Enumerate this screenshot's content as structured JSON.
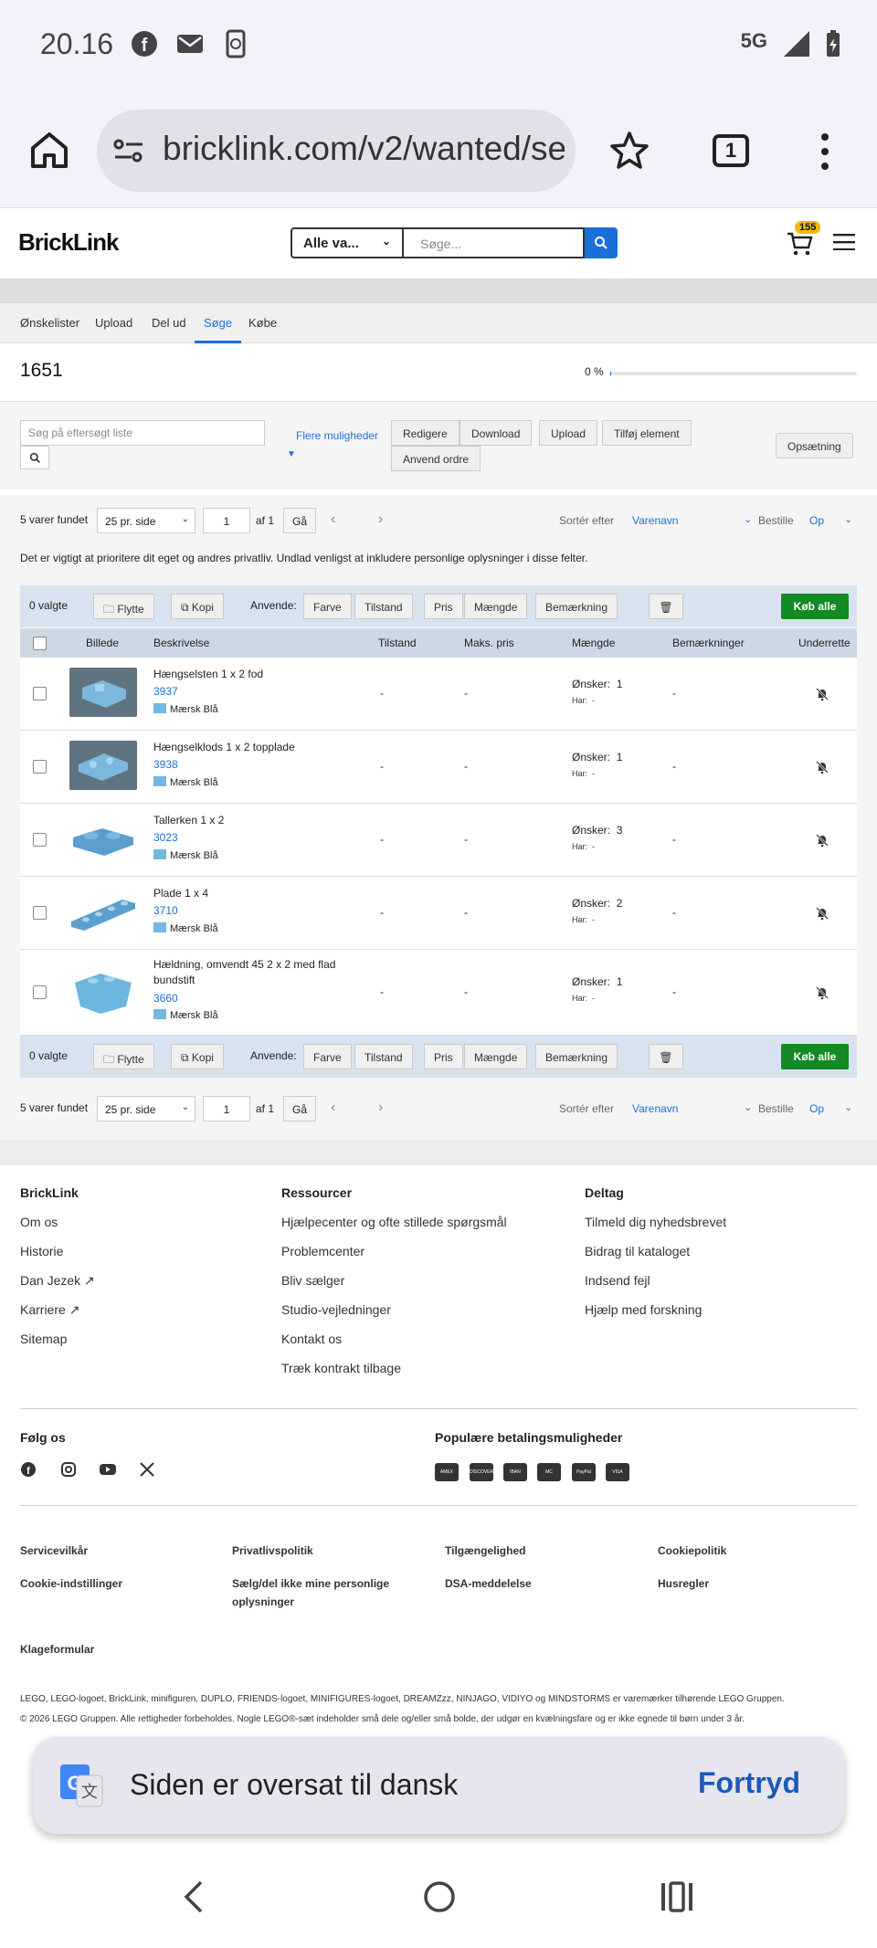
{
  "status": {
    "time": "20.16",
    "network": "5G"
  },
  "browser": {
    "url": "bricklink.com/v2/wanted/se",
    "tab_count": "1"
  },
  "header": {
    "logo": "BrickLink",
    "category": "Alle va...",
    "search_placeholder": "Søge...",
    "cart_badge": "155"
  },
  "tabs": [
    "Ønskelister",
    "Upload",
    "Del ud",
    "Søge",
    "Købe"
  ],
  "summary": {
    "count": "1651",
    "progress_label": "0 %",
    "progress": 0
  },
  "tools": {
    "filter_placeholder": "Søg på eftersøgt liste",
    "more_options": "Flere muligheder",
    "buttons": [
      "Redigere",
      "Download",
      "Upload",
      "Tilføj element"
    ],
    "apply_order": "Anvend ordre",
    "setup": "Opsætning"
  },
  "pager": {
    "found": "5 varer fundet",
    "per_page": "25 pr. side",
    "page": "1",
    "of": "af 1",
    "go": "Gå",
    "sort_label": "Sortér efter",
    "sort_value": "Varenavn",
    "order_label": "Bestille",
    "order_value": "Op"
  },
  "privacy_note": "Det er vigtigt at prioritere dit eget og andres privatliv. Undlad venligst at inkludere personlige oplysninger i disse felter.",
  "actions": {
    "selected": "0 valgte",
    "move": "Flytte",
    "copy": "Kopi",
    "apply": "Anvende:",
    "fields": [
      "Farve",
      "Tilstand",
      "Pris",
      "Mængde",
      "Bemærkning"
    ],
    "buy_all": "Køb alle"
  },
  "table": {
    "headers": [
      "Billede",
      "Beskrivelse",
      "Tilstand",
      "Maks. pris",
      "Mængde",
      "Bemærkninger",
      "Underrette"
    ],
    "want_label": "Ønsker:",
    "have_label": "Har:",
    "rows": [
      {
        "name": "Hængselsten 1 x 2 fod",
        "number": "3937",
        "color": "Mærsk Blå",
        "condition": "-",
        "max_price": "-",
        "wants": "1",
        "has": "-",
        "remarks": "-"
      },
      {
        "name": "Hængselklods 1 x 2 topplade",
        "number": "3938",
        "color": "Mærsk Blå",
        "condition": "-",
        "max_price": "-",
        "wants": "1",
        "has": "-",
        "remarks": "-"
      },
      {
        "name": "Tallerken 1 x 2",
        "number": "3023",
        "color": "Mærsk Blå",
        "condition": "-",
        "max_price": "-",
        "wants": "3",
        "has": "-",
        "remarks": "-"
      },
      {
        "name": "Plade 1 x 4",
        "number": "3710",
        "color": "Mærsk Blå",
        "condition": "-",
        "max_price": "-",
        "wants": "2",
        "has": "-",
        "remarks": "-"
      },
      {
        "name": "Hældning, omvendt 45 2 x 2 med flad bundstift",
        "number": "3660",
        "color": "Mærsk Blå",
        "condition": "-",
        "max_price": "-",
        "wants": "1",
        "has": "-",
        "remarks": "-"
      }
    ]
  },
  "footer": {
    "col1": {
      "title": "BrickLink",
      "links": [
        "Om os",
        "Historie",
        "Dan Jezek",
        "Karriere",
        "Sitemap"
      ]
    },
    "col2": {
      "title": "Ressourcer",
      "links": [
        "Hjælpecenter og ofte stillede spørgsmål",
        "Problemcenter",
        "Bliv sælger",
        "Studio-vejledninger",
        "Kontakt os",
        "Træk kontrakt tilbage"
      ]
    },
    "col3": {
      "title": "Deltag",
      "links": [
        "Tilmeld dig nyhedsbrevet",
        "Bidrag til kataloget",
        "Indsend fejl",
        "Hjælp med forskning"
      ]
    },
    "follow": "Følg os",
    "payments": "Populære betalingsmuligheder",
    "payment_icons": [
      "AMEX",
      "DISCOVER",
      "IBAN",
      "MC",
      "PayPal",
      "VISA"
    ],
    "legal_links": [
      "Servicevilkår",
      "Privatlivspolitik",
      "Tilgængelighed",
      "Cookiepolitik",
      "Cookie-indstillinger",
      "Sælg/del ikke mine personlige oplysninger",
      "DSA-meddelelse",
      "Husregler",
      "Klageformular"
    ],
    "legal_text_1": "LEGO, LEGO-logoet, BrickLink, minifiguren, DUPLO, FRIENDS-logoet, MINIFIGURES-logoet, DREAMZzz, NINJAGO, VIDIYO og MINDSTORMS er varemærker tilhørende LEGO Gruppen.",
    "legal_text_2": "© 2026 LEGO Gruppen. Alle rettigheder forbeholdes. Nogle LEGO®-sæt indeholder små dele og/eller små bolde, der udgør en kvælningsfare og er ikke egnede til børn under 3 år."
  },
  "toast": {
    "message": "Siden er oversat til dansk",
    "undo": "Fortryd"
  },
  "colors": {
    "accent": "#1c6fd8",
    "buy": "#138a23",
    "swatch": "#74b8e0"
  }
}
